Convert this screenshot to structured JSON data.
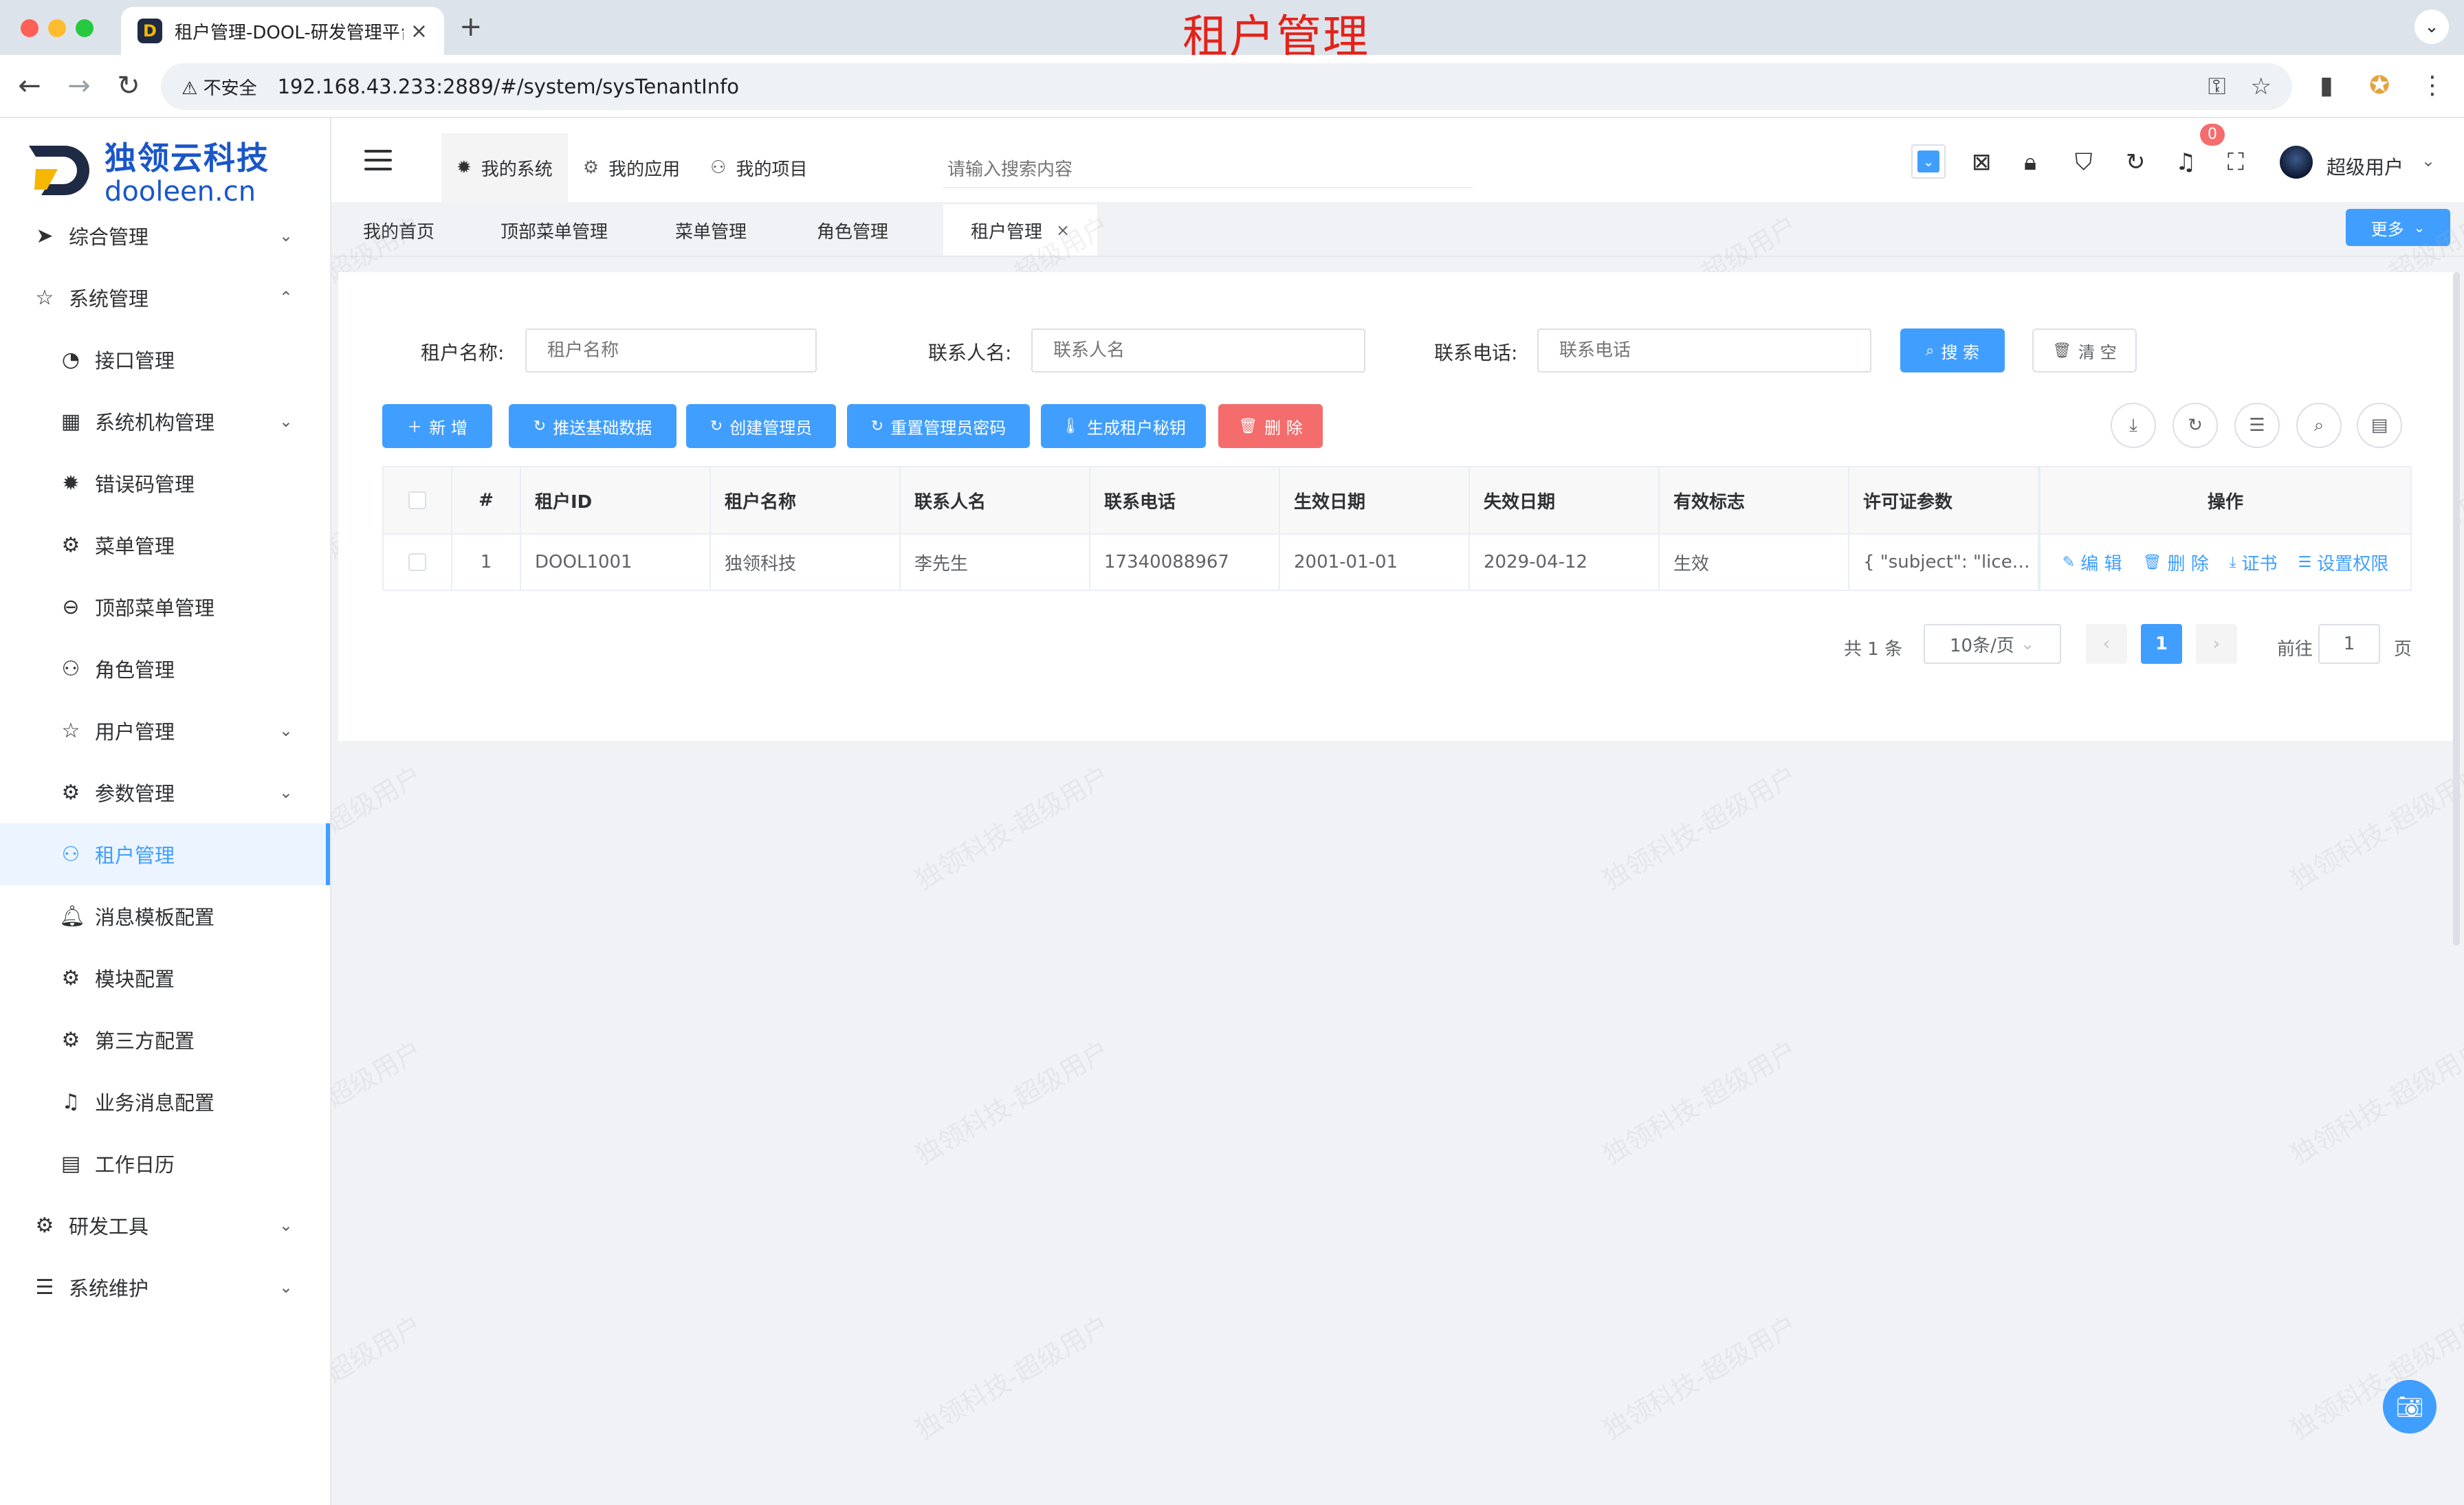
{
  "browser": {
    "tab_title": "租户管理-DOOL-研发管理平台",
    "tab_close": "×",
    "new_tab": "+",
    "overlay_title": "租户管理",
    "security_label": "不安全",
    "url": "192.168.43.233:2889/#/system/sysTenantInfo",
    "favicon_letter": "D"
  },
  "colors": {
    "primary": "#409eff",
    "danger": "#f56c6c",
    "brand": "#1a56c8",
    "overlay_red": "#e3231b"
  },
  "logo": {
    "cn": "独领云科技",
    "en": "dooleen.cn"
  },
  "sidebar": {
    "items": [
      {
        "label": "综合管理",
        "icon": "paper-plane-icon",
        "level": 1,
        "arrow": "down"
      },
      {
        "label": "系统管理",
        "icon": "star-icon",
        "level": 1,
        "arrow": "up"
      },
      {
        "label": "接口管理",
        "icon": "dashboard-icon",
        "level": 2
      },
      {
        "label": "系统机构管理",
        "icon": "grid-icon",
        "level": 2,
        "arrow": "down"
      },
      {
        "label": "错误码管理",
        "icon": "gear-solid-icon",
        "level": 2
      },
      {
        "label": "菜单管理",
        "icon": "gear-icon",
        "level": 2
      },
      {
        "label": "顶部菜单管理",
        "icon": "zoom-out-icon",
        "level": 2
      },
      {
        "label": "角色管理",
        "icon": "user-icon",
        "level": 2
      },
      {
        "label": "用户管理",
        "icon": "star-icon",
        "level": 2,
        "arrow": "down"
      },
      {
        "label": "参数管理",
        "icon": "gear-icon",
        "level": 2,
        "arrow": "down"
      },
      {
        "label": "租户管理",
        "icon": "user-icon",
        "level": 2,
        "active": true
      },
      {
        "label": "消息模板配置",
        "icon": "bell-solid-icon",
        "level": 2
      },
      {
        "label": "模块配置",
        "icon": "gear-icon",
        "level": 2
      },
      {
        "label": "第三方配置",
        "icon": "gear-icon",
        "level": 2
      },
      {
        "label": "业务消息配置",
        "icon": "bell-icon",
        "level": 2
      },
      {
        "label": "工作日历",
        "icon": "calendar-icon",
        "level": 2
      },
      {
        "label": "研发工具",
        "icon": "gear-icon",
        "level": 1,
        "arrow": "down"
      },
      {
        "label": "系统维护",
        "icon": "sliders-icon",
        "level": 1,
        "arrow": "down"
      }
    ]
  },
  "header": {
    "top_menu": [
      {
        "label": "我的系统",
        "icon": "gear-solid-icon",
        "active": true
      },
      {
        "label": "我的应用",
        "icon": "gear-icon"
      },
      {
        "label": "我的项目",
        "icon": "user-icon"
      }
    ],
    "search_placeholder": "请输入搜索内容",
    "notification_count": "0",
    "user_name": "超级用户"
  },
  "tags": {
    "items": [
      {
        "label": "我的首页"
      },
      {
        "label": "顶部菜单管理"
      },
      {
        "label": "菜单管理"
      },
      {
        "label": "角色管理"
      },
      {
        "label": "租户管理",
        "active": true,
        "closable": true
      }
    ],
    "more_label": "更多"
  },
  "search_form": {
    "tenant_name_label": "租户名称:",
    "tenant_name_placeholder": "租户名称",
    "contact_name_label": "联系人名:",
    "contact_name_placeholder": "联系人名",
    "phone_label": "联系电话:",
    "phone_placeholder": "联系电话",
    "search_button": "搜 索",
    "clear_button": "清 空"
  },
  "toolbar": {
    "add": "新 增",
    "push_base_data": "推送基础数据",
    "create_admin": "创建管理员",
    "reset_admin_password": "重置管理员密码",
    "gen_tenant_secret": "生成租户秘钥",
    "delete": "删 除"
  },
  "table": {
    "columns": [
      "#",
      "租户ID",
      "租户名称",
      "联系人名",
      "联系电话",
      "生效日期",
      "失效日期",
      "有效标志",
      "许可证参数",
      "操作"
    ],
    "rows": [
      {
        "index": "1",
        "tenant_id": "DOOL1001",
        "tenant_name": "独领科技",
        "contact_name": "李先生",
        "phone": "17340088967",
        "start_date": "2001-01-01",
        "end_date": "2029-04-12",
        "valid_flag": "生效",
        "license": "{ \"subject\": \"lice…"
      }
    ],
    "row_actions": {
      "edit": "编 辑",
      "delete": "删 除",
      "certificate": "证书",
      "set_permissions": "设置权限"
    }
  },
  "pagination": {
    "total": "共 1 条",
    "page_size": "10条/页",
    "current_page": "1",
    "goto_prefix": "前往",
    "goto_value": "1",
    "goto_suffix": "页"
  }
}
